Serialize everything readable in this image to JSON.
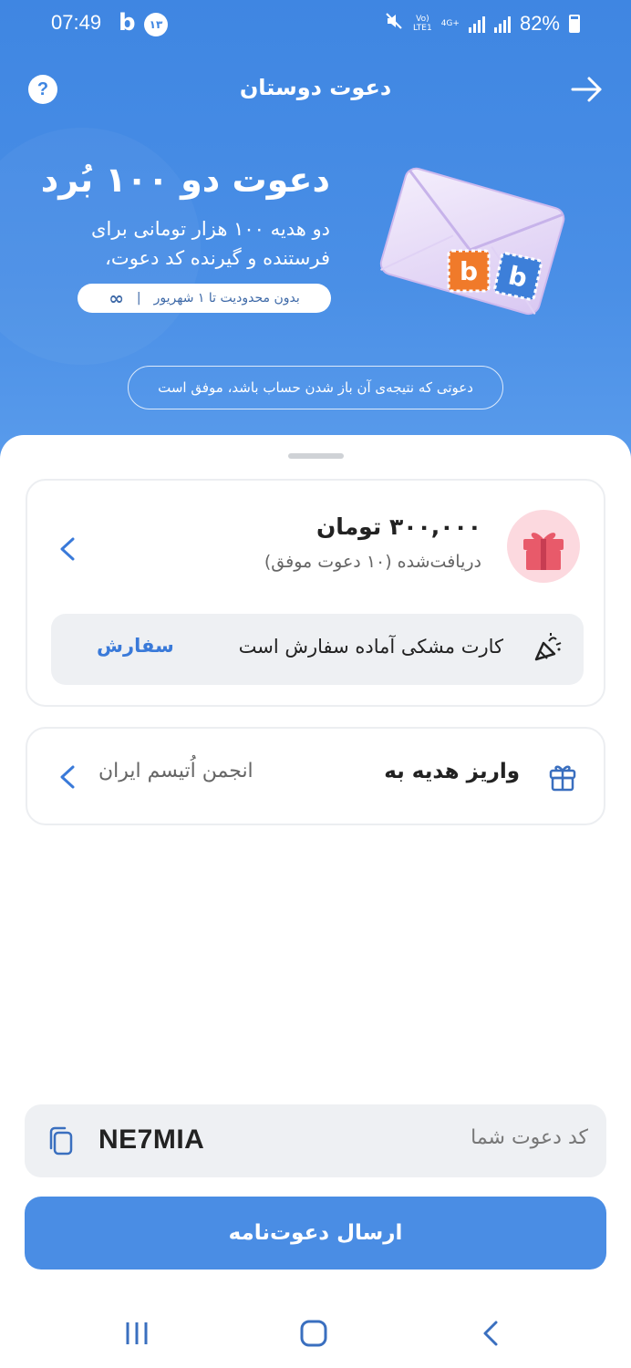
{
  "status_bar": {
    "time": "07:49",
    "app_logo": "b",
    "notification_count": "۱۳",
    "network_top": "Vo)",
    "network_bottom": "LTE1",
    "network2_top": "4G+",
    "battery": "82%"
  },
  "header": {
    "title": "دعوت دوستان",
    "help_label": "?"
  },
  "promo": {
    "title": "دعوت دو ۱۰۰ بُرد",
    "description": "دو هدیه ۱۰۰ هزار تومانی برای فرستنده و گیرنده کد دعوت،",
    "pill_text": "بدون محدودیت تا ۱ شهریور",
    "pill_separator": "|",
    "pill_icon": "∞",
    "stamp_letter": "b"
  },
  "hint": "دعوتی که نتیجه‌ی آن باز شدن حساب باشد، موفق است",
  "reward": {
    "amount": "۳۰۰,۰۰۰ تومان",
    "received": "دریافت‌شده (۱۰ دعوت موفق)",
    "order_text": "کارت مشکی آماده سفارش است",
    "order_link": "سفارش"
  },
  "donate": {
    "label": "واریز هدیه به",
    "target": "انجمن اُتیسم ایران"
  },
  "invite_code": {
    "label": "کد دعوت شما",
    "value": "NE7MIA"
  },
  "send_button": "ارسال دعوت‌نامه",
  "colors": {
    "primary": "#4a8de4",
    "hero_top": "#3f86e2",
    "gift_bg": "#fcd9df",
    "gift": "#e85a6a",
    "stamp_orange": "#f07a2a",
    "stamp_blue": "#3d7fd9"
  },
  "icons": {
    "help": "question-icon",
    "back": "arrow-right-icon",
    "gift": "gift-box-icon",
    "chevron": "chevron-left-icon",
    "party": "party-popper-icon",
    "donate": "gift-outline-icon",
    "copy": "copy-icon"
  }
}
